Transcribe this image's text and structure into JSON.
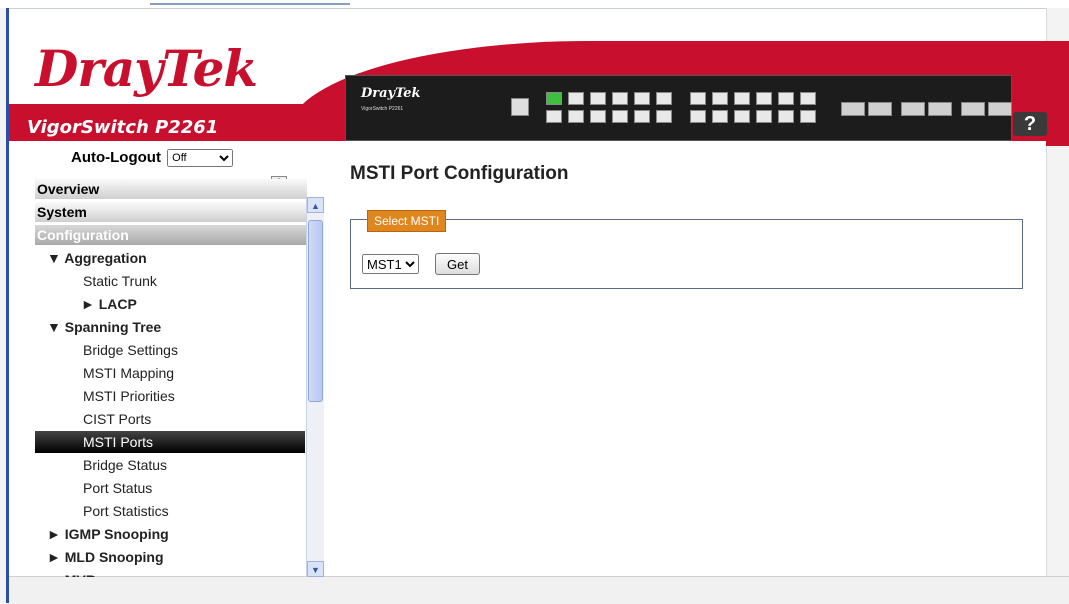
{
  "header": {
    "logo": "DrayTek",
    "model": "VigorSwitch P2261",
    "device_brand": "DrayTek",
    "device_model": "VigorSwitch P2261",
    "help_label": "?"
  },
  "sidebar": {
    "auto_logout_label": "Auto-Logout",
    "auto_logout_value": "Off",
    "sections": {
      "overview": "Overview",
      "system": "System",
      "configuration": "Configuration"
    },
    "tree": [
      {
        "label": "▼ Aggregation",
        "level": 1
      },
      {
        "label": "Static Trunk",
        "level": 2
      },
      {
        "label": "► LACP",
        "level": 3
      },
      {
        "label": "▼ Spanning Tree",
        "level": 1
      },
      {
        "label": "Bridge Settings",
        "level": 2
      },
      {
        "label": "MSTI Mapping",
        "level": 2
      },
      {
        "label": "MSTI Priorities",
        "level": 2
      },
      {
        "label": "CIST Ports",
        "level": 2
      },
      {
        "label": "MSTI Ports",
        "level": 2,
        "selected": true
      },
      {
        "label": "Bridge Status",
        "level": 2
      },
      {
        "label": "Port Status",
        "level": 2
      },
      {
        "label": "Port Statistics",
        "level": 2
      },
      {
        "label": "► IGMP Snooping",
        "level": 1
      },
      {
        "label": "► MLD Snooping",
        "level": 1
      },
      {
        "label": "► MVR",
        "level": 1
      }
    ]
  },
  "main": {
    "title": "MSTI Port Configuration",
    "legend": "Select MSTI",
    "msti_value": "MST1",
    "get_label": "Get"
  },
  "colors": {
    "brand_red": "#c8102e",
    "legend_orange": "#e0861f",
    "selected_bg": "#000000"
  }
}
